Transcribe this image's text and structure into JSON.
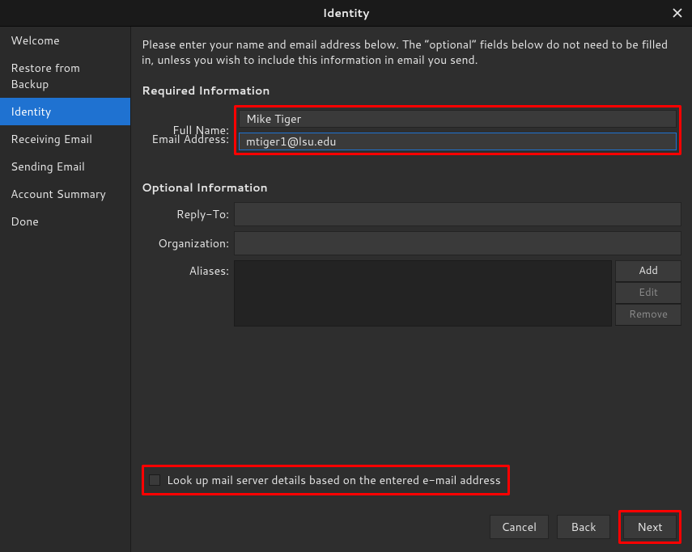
{
  "window": {
    "title": "Identity"
  },
  "sidebar": {
    "items": [
      {
        "label": "Welcome"
      },
      {
        "label": "Restore from Backup"
      },
      {
        "label": "Identity"
      },
      {
        "label": "Receiving Email"
      },
      {
        "label": "Sending Email"
      },
      {
        "label": "Account Summary"
      },
      {
        "label": "Done"
      }
    ],
    "active_index": 2
  },
  "main": {
    "intro": "Please enter your name and email address below. The “optional” fields below do not need to be filled in, unless you wish to include this information in email you send.",
    "required_header": "Required Information",
    "optional_header": "Optional Information",
    "labels": {
      "full_name": "Full Name:",
      "email": "Email Address:",
      "reply_to": "Reply-To:",
      "organization": "Organization:",
      "aliases": "Aliases:"
    },
    "values": {
      "full_name": "Mike Tiger",
      "email": "mtiger1@lsu.edu",
      "reply_to": "",
      "organization": ""
    },
    "alias_buttons": {
      "add": "Add",
      "edit": "Edit",
      "remove": "Remove"
    },
    "lookup_label": "Look up mail server details based on the entered e-mail address",
    "lookup_checked": false
  },
  "footer": {
    "cancel": "Cancel",
    "back": "Back",
    "next": "Next"
  }
}
